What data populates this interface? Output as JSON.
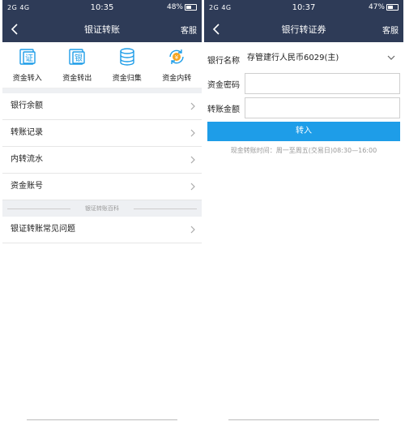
{
  "left": {
    "status": {
      "signal": "2G 4G",
      "time": "10:35",
      "battery": "48%"
    },
    "header": {
      "title": "银证转账",
      "service": "客服"
    },
    "quick_actions": [
      {
        "label": "资金转入",
        "icon": "transfer-in-icon"
      },
      {
        "label": "资金转出",
        "icon": "transfer-out-icon"
      },
      {
        "label": "资金归集",
        "icon": "fund-collect-icon"
      },
      {
        "label": "资金内转",
        "icon": "internal-transfer-icon"
      }
    ],
    "menu": [
      {
        "label": "银行余额"
      },
      {
        "label": "转账记录"
      },
      {
        "label": "内转流水"
      },
      {
        "label": "资金账号"
      }
    ],
    "section_title": "银证转账百科",
    "faq": {
      "label": "银证转账常见问题"
    }
  },
  "right": {
    "status": {
      "signal": "2G 4G",
      "time": "10:37",
      "battery": "47%"
    },
    "header": {
      "title": "银行转证券",
      "service": "客服"
    },
    "form": {
      "bank_label": "银行名称",
      "bank_value": "存管建行人民币6029(主)",
      "password_label": "资金密码",
      "password_value": "",
      "amount_label": "转账金额",
      "amount_value": ""
    },
    "submit_label": "转入",
    "hint": "现金转账时间：周一至周五(交易日)08:30—16:00"
  },
  "colors": {
    "header": "#2e3b57",
    "accent": "#1e9de8"
  }
}
